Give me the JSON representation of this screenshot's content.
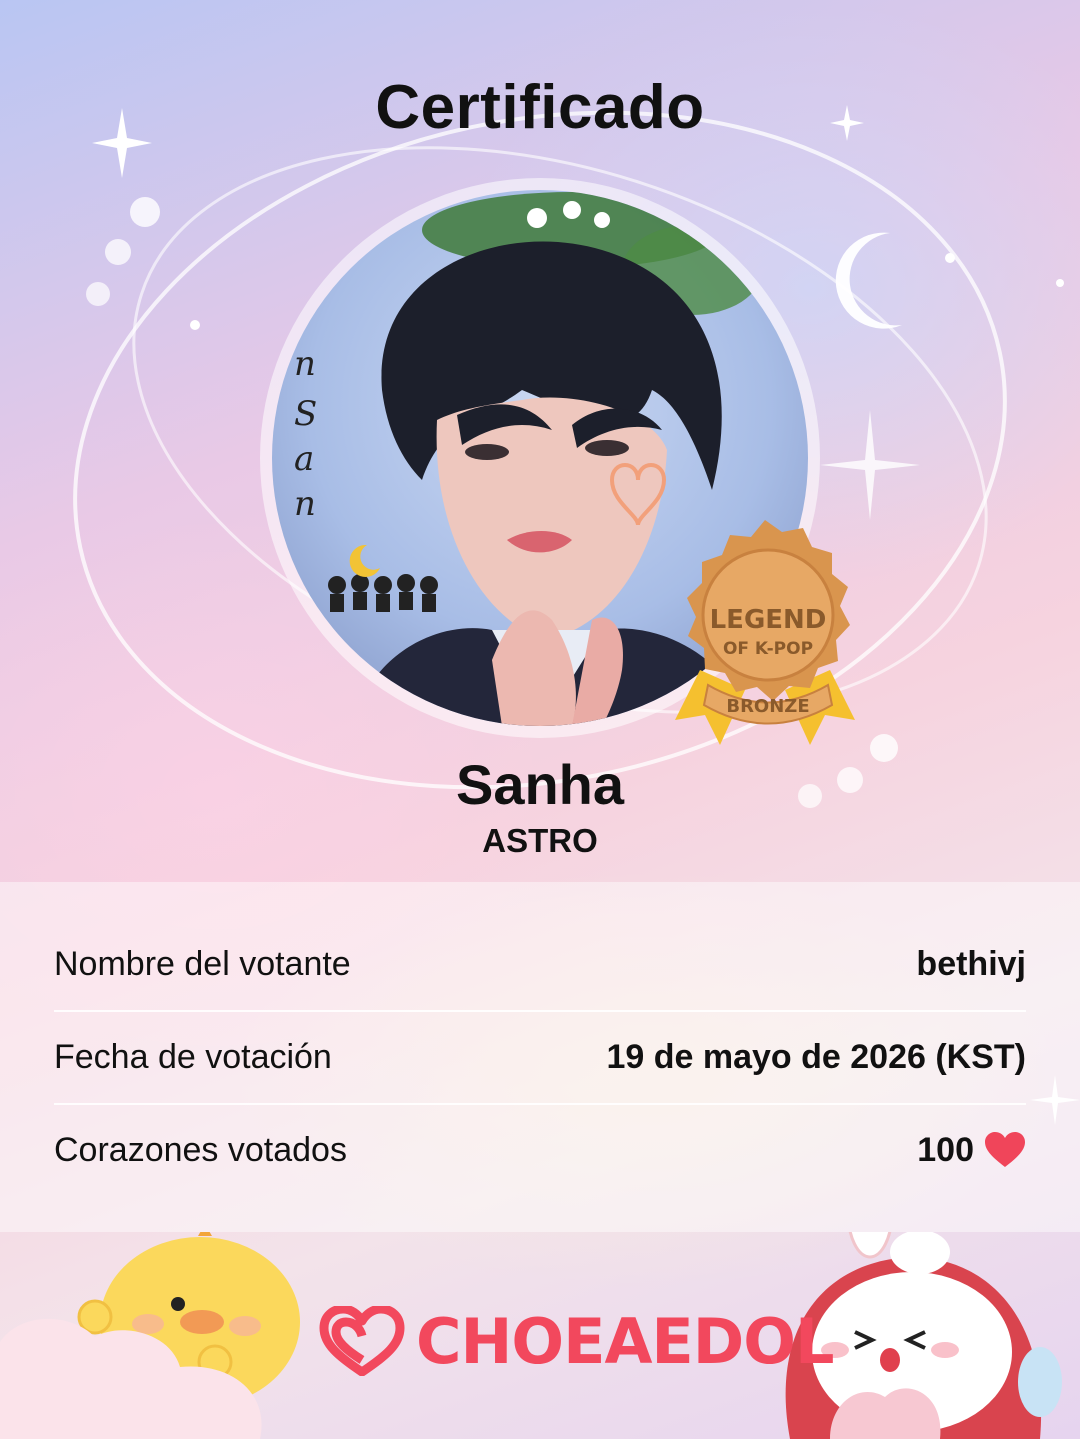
{
  "certificate": {
    "title": "Certificado",
    "idol_name": "Sanha",
    "group": "ASTRO"
  },
  "badge": {
    "line1": "LEGEND",
    "line2": "OF K-POP",
    "tier": "BRONZE"
  },
  "rows": [
    {
      "label": "Nombre del votante",
      "value": "bethivj"
    },
    {
      "label": "Fecha de votación",
      "value": "19 de mayo de 2026 (KST)"
    },
    {
      "label": "Corazones votados",
      "value": "100"
    }
  ],
  "brand": {
    "name": "CHOEAEDOL"
  },
  "colors": {
    "brand": "#f2485d",
    "heart": "#f0455a",
    "badge_bronze": "#d9954e",
    "ribbon": "#f5c02f"
  },
  "icons": [
    "heart-icon",
    "choeaedol-logo-icon",
    "moon-icon",
    "sparkle-icon",
    "chick-mascot",
    "bunny-mascot"
  ]
}
